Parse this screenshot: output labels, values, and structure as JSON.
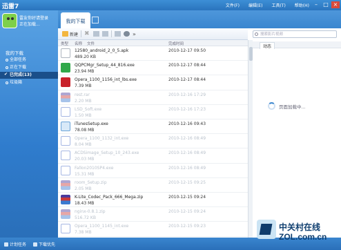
{
  "app": {
    "title": "迅雷7"
  },
  "menu": [
    "文件(F)",
    "编辑(E)",
    "工具(T)",
    "帮助(H)"
  ],
  "window_controls": [
    "minimize-icon",
    "maximize-icon",
    "close-icon"
  ],
  "user": {
    "line1": "雷友你好请登录",
    "line2": "正在加载..."
  },
  "sidebar": {
    "heading": "我的下载",
    "items": [
      {
        "label": "全部任务",
        "selected": false
      },
      {
        "label": "正在下载",
        "selected": false
      },
      {
        "label": "已完成(13)",
        "selected": true
      },
      {
        "label": "垃圾箱",
        "selected": false
      }
    ]
  },
  "tabs": {
    "active": "我的下载"
  },
  "toolbar": {
    "new_label": "新建",
    "more": "»"
  },
  "columns": {
    "type": "类型",
    "name": "名称",
    "name_sort": "文件",
    "date": "完成时间"
  },
  "files": [
    {
      "name": "12580_android_2_0_5.apk",
      "size": "489.20 KB",
      "date": "2010-12-17 09:50",
      "icon": "apk-icon",
      "faded": false
    },
    {
      "name": "QQPCMgr_Setup_44_816.exe",
      "size": "23.94 MB",
      "date": "2010-12-17 08:44",
      "icon": "exe-icon",
      "faded": false
    },
    {
      "name": "Opera_1100_1156_int_lbs.exe",
      "size": "7.39 MB",
      "date": "2010-12-17 08:44",
      "icon": "opera-icon",
      "faded": false
    },
    {
      "name": "rest.rar",
      "size": "2.20 MB",
      "date": "2010-12-16 17:29",
      "icon": "rar-icon",
      "faded": true
    },
    {
      "name": "LSD_Soft.exe",
      "size": "1.50 MB",
      "date": "2010-12-16 17:23",
      "icon": "window-icon",
      "faded": true
    },
    {
      "name": "iTunesSetup.exe",
      "size": "78.08 MB",
      "date": "2010-12-16 09:43",
      "icon": "itunes-icon",
      "faded": false
    },
    {
      "name": "Opera_1100_1132_int.exe",
      "size": "8.04 MB",
      "date": "2010-12-16 08:49",
      "icon": "window-icon",
      "faded": true
    },
    {
      "name": "ACDSimage_Setup_10_243.exe",
      "size": "20.03 MB",
      "date": "2010-12-16 08:49",
      "icon": "window-icon",
      "faded": true
    },
    {
      "name": "Fallon2010SP4.exe",
      "size": "15.31 MB",
      "date": "2010-12-16 08:49",
      "icon": "window-icon",
      "faded": true
    },
    {
      "name": "room_Setup.zip",
      "size": "2.05 MB",
      "date": "2010-12-15 09:25",
      "icon": "rar-icon",
      "faded": true
    },
    {
      "name": "K-Lite_Codec_Pack_666_Mega.zip",
      "size": "18.43 MB",
      "date": "2010-12-15 09:24",
      "icon": "rar-icon",
      "faded": false
    },
    {
      "name": "nginx-0.8.1.zip",
      "size": "516.72 KB",
      "date": "2010-12-15 09:24",
      "icon": "rar-icon",
      "faded": true
    },
    {
      "name": "Opera_1100_1145_int.exe",
      "size": "7.38 MB",
      "date": "2010-12-15 09:23",
      "icon": "window-icon",
      "faded": true
    }
  ],
  "right_pane": {
    "search_placeholder": "搜索影片视频",
    "tab": "动态",
    "loading": "页面加载中..."
  },
  "status": {
    "left": "计划任务",
    "right": "下载优先"
  },
  "watermark": {
    "text": "中关村在线",
    "domain": "ZOL.com.cn"
  },
  "colors": {
    "titlebar": "#2a74bd",
    "sidebar": "#2f7ccd",
    "selected_item": "#1a4f8a",
    "faded_text": "#b9c1cb"
  }
}
